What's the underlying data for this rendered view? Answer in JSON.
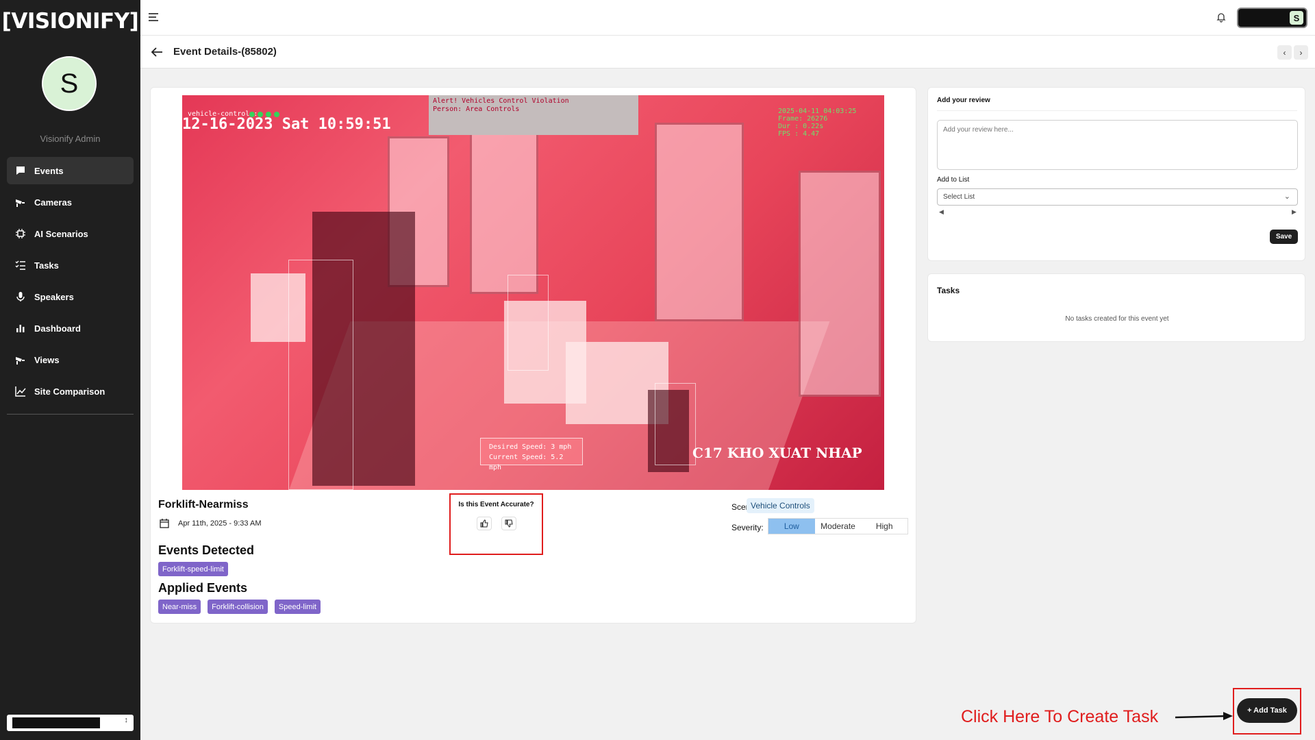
{
  "brand": {
    "logo_text": "[VISIONIFY]"
  },
  "user": {
    "initial": "S",
    "name": "Visionify Admin"
  },
  "sidebar": {
    "items": [
      {
        "label": "Events",
        "icon": "chat-bubble-icon",
        "active": true
      },
      {
        "label": "Cameras",
        "icon": "cctv-camera-icon",
        "active": false
      },
      {
        "label": "AI Scenarios",
        "icon": "cpu-chip-icon",
        "active": false
      },
      {
        "label": "Tasks",
        "icon": "task-list-icon",
        "active": false
      },
      {
        "label": "Speakers",
        "icon": "microphone-icon",
        "active": false
      },
      {
        "label": "Dashboard",
        "icon": "bar-chart-icon",
        "active": false
      },
      {
        "label": "Views",
        "icon": "cctv-camera-icon",
        "active": false
      },
      {
        "label": "Site Comparison",
        "icon": "line-chart-icon",
        "active": false
      }
    ]
  },
  "topbar": {
    "account_initial": "S"
  },
  "header": {
    "title": "Event Details-(85802)"
  },
  "video": {
    "alert_line1": "Alert! Vehicles Control Violation",
    "alert_line2": "Person: Area Controls",
    "timestamp": "12-16-2023 Sat 10:59:51",
    "camera_label": "vehicle-controls:",
    "meta_line1": "2025-04-11 04:03:25",
    "meta_line2": "Frame: 26276",
    "meta_line3": "Dur  : 0.22s",
    "meta_line4": "FPS  : 4.47",
    "desired_speed": "Desired Speed: 3 mph",
    "current_speed": "Current Speed: 5.2 mph",
    "warehouse_text": "C17 KHO XUAT NHAP"
  },
  "event": {
    "title": "Forklift-Nearmiss",
    "date": "Apr 11th, 2025 - 9:33 AM",
    "events_detected_title": "Events Detected",
    "events_detected": [
      "Forklift-speed-limit"
    ],
    "applied_events_title": "Applied Events",
    "applied_events": [
      "Near-miss",
      "Forklift-collision",
      "Speed-limit"
    ]
  },
  "accuracy": {
    "question": "Is this Event Accurate?"
  },
  "scenario": {
    "label": "Scenario:",
    "value": "Vehicle Controls"
  },
  "severity": {
    "label": "Severity:",
    "options": [
      "Low",
      "Moderate",
      "High"
    ],
    "selected": "Low"
  },
  "review": {
    "title": "Add your review",
    "placeholder": "Add your review here...",
    "list_label": "Add to List",
    "list_placeholder": "Select List",
    "save_label": "Save"
  },
  "tasks": {
    "title": "Tasks",
    "empty_text": "No tasks created for this event yet"
  },
  "annotation": {
    "cta_text": "Click Here To Create Task"
  },
  "add_task": {
    "label": "+ Add Task"
  },
  "colors": {
    "sidebar_bg": "#1f1f1f",
    "tag_purple": "#7f65c9",
    "severity_selected": "#8ec0ef",
    "annotation_red": "#e01d1d"
  }
}
